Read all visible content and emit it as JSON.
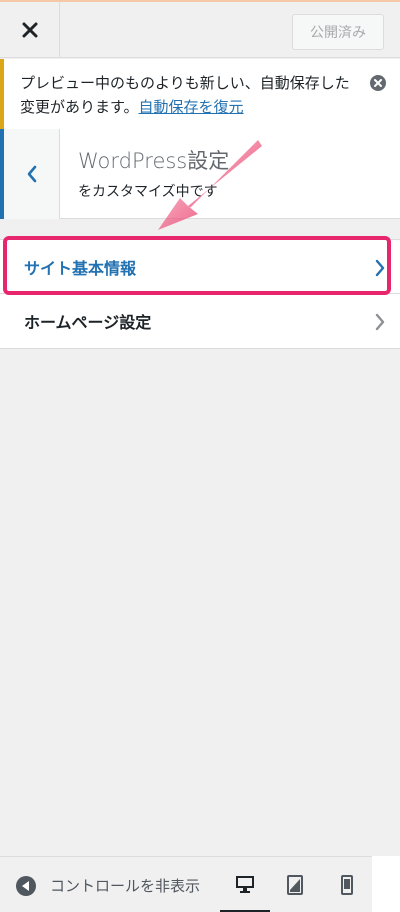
{
  "header": {
    "close_icon": "close-icon",
    "publish_label": "公開済み"
  },
  "notice": {
    "text": "プレビュー中のものよりも新しい、自動保存した変更があります。",
    "link": "自動保存を復元",
    "accent_color": "#dba617",
    "dismiss_icon": "dismiss-icon"
  },
  "section": {
    "title": "WordPress設定",
    "subtitle": "をカスタマイズ中です",
    "back_icon": "chevron-left-icon"
  },
  "menu": [
    {
      "label": "サイト基本情報",
      "icon": "chevron-right-icon",
      "highlighted": true
    },
    {
      "label": "ホームページ設定",
      "icon": "chevron-right-icon"
    }
  ],
  "annotation": {
    "color": "#e8266e",
    "arrow_icon": "arrow-annotation-icon"
  },
  "footer": {
    "collapse_label": "コントロールを非表示",
    "devices": [
      "desktop-icon",
      "tablet-icon",
      "mobile-icon"
    ]
  },
  "colors": {
    "link": "#2271b1",
    "border": "#dcdcde",
    "background": "#f0f0f1"
  }
}
